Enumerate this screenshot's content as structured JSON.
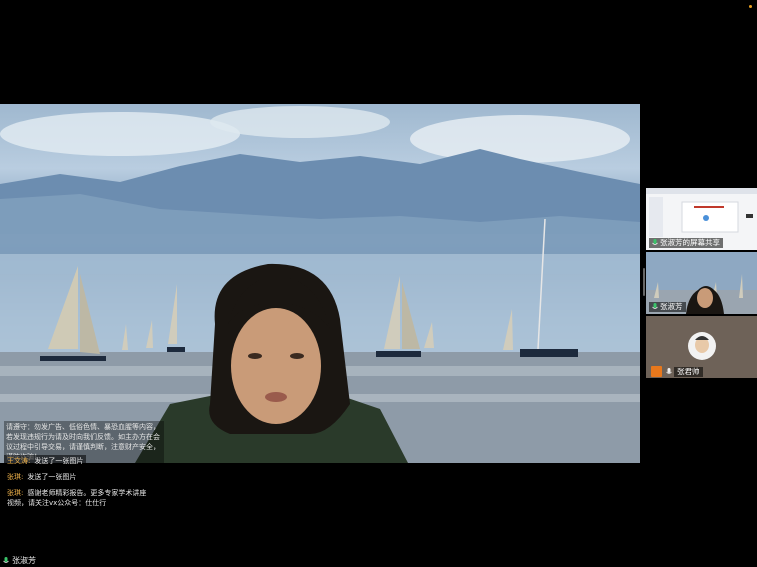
{
  "overlay_messages": {
    "system": "请遵守：勿发广告、低俗色情、暴恐血腥等内容，若发现违规行为请及时向我们反馈。如主办方在会议过程中引导交易，请谨慎判断，注意财产安全，谨防诈骗！",
    "chat": [
      {
        "name": "王文涛:",
        "text": "发送了一张图片"
      },
      {
        "name": "张琪:",
        "text": "发送了一张图片"
      },
      {
        "name": "张琪:",
        "text": "感谢老师精彩报告。更多专家学术讲座视频，请关注vx公众号：仕仕行"
      }
    ]
  },
  "participants": [
    {
      "label": "张淑芳的屏幕共享",
      "icon": "mic-icon"
    },
    {
      "label": "张淑芳",
      "icon": "mic-icon"
    },
    {
      "label": "张君帅",
      "icon": "mic-icon"
    }
  ],
  "active_speaker": {
    "name": "张淑芳"
  },
  "colors": {
    "accent": "#f0b34a",
    "host_badge": "#e8781c"
  }
}
